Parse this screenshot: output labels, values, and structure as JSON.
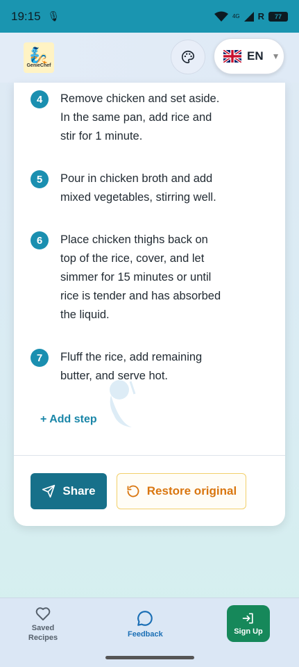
{
  "status": {
    "time": "19:15",
    "network": "4G",
    "roaming": "R",
    "battery": "77"
  },
  "header": {
    "logo_text": "GenieChef",
    "language": "EN"
  },
  "steps": [
    {
      "num": "4",
      "text": "Remove chicken and set aside. In the same pan, add rice and stir for 1 minute."
    },
    {
      "num": "5",
      "text": "Pour in chicken broth and add mixed vegetables, stirring well."
    },
    {
      "num": "6",
      "text": "Place chicken thighs back on top of the rice, cover, and let simmer for 15 minutes or until rice is tender and has absorbed the liquid."
    },
    {
      "num": "7",
      "text": "Fluff the rice, add remaining butter, and serve hot."
    }
  ],
  "actions": {
    "add_step": "+ Add step",
    "share": "Share",
    "restore": "Restore original"
  },
  "nav": {
    "saved": "Saved Recipes",
    "feedback": "Feedback",
    "signup": "Sign Up"
  },
  "colors": {
    "accent": "#1a8fb0",
    "share_bg": "#17708a",
    "restore_text": "#d9760f",
    "signup_bg": "#16885a"
  }
}
